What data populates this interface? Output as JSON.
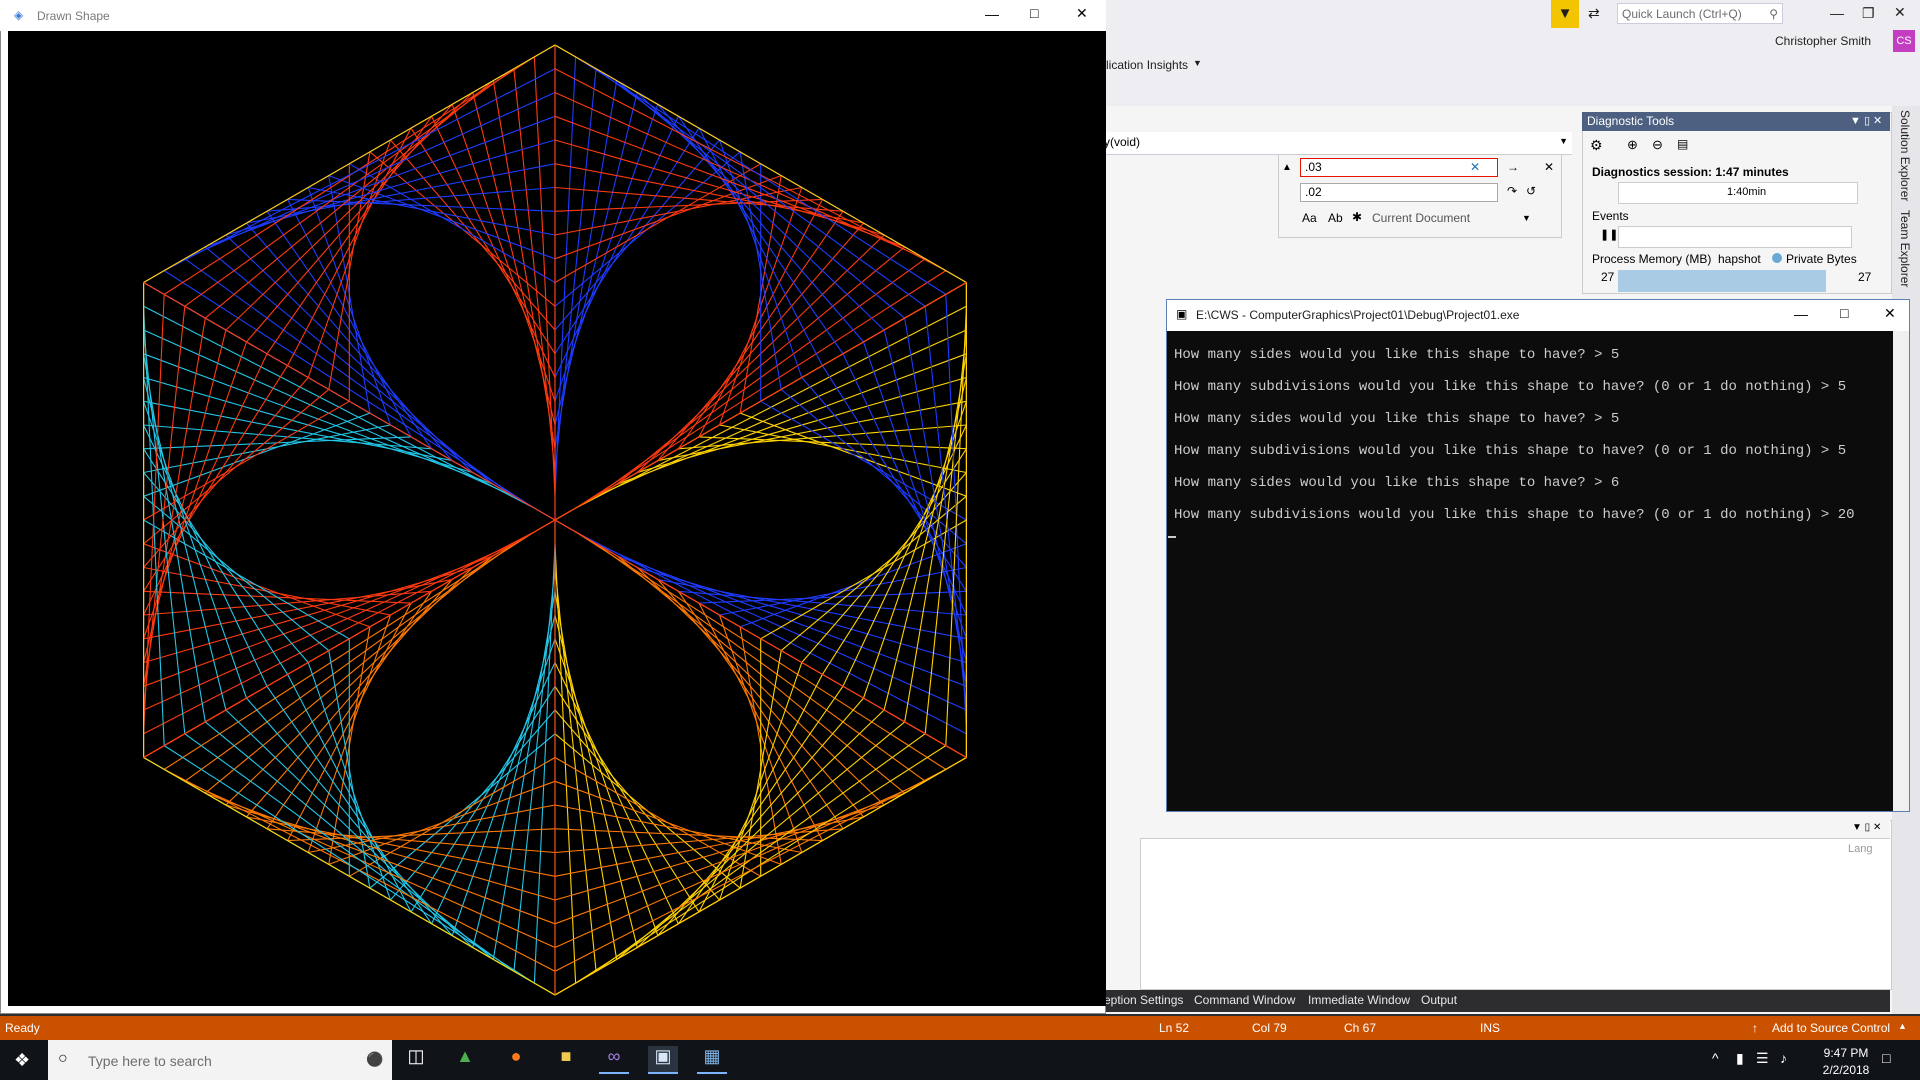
{
  "shape_window": {
    "title": "Drawn Shape",
    "colors": [
      "#1e3cff",
      "#22c7e8",
      "#ffd400",
      "#ff3a10",
      "#ff7a00"
    ],
    "sides": 6,
    "subdivisions": 20
  },
  "vs": {
    "quick_launch_placeholder": "Quick Launch (Ctrl+Q)",
    "user": "Christopher Smith",
    "user_initials": "CS",
    "app_insights": "lication Insights",
    "func_sig": "y(void)",
    "find": {
      "value": ".03",
      "replace_value": ".02",
      "scope": "Current Document",
      "match_case": "Aa",
      "whole_word": "Ab"
    },
    "diagnostic": {
      "title": "Diagnostic Tools",
      "session": "Diagnostics session: 1:47 minutes",
      "timeline_label": "1:40min",
      "events_label": "Events",
      "process_memory_label": "Process Memory (MB)",
      "snapshot_label": "hapshot",
      "private_bytes_label": "Private Bytes",
      "memory_left": "27",
      "memory_right": "27"
    },
    "rails": [
      "Solution Explorer",
      "Team Explorer"
    ],
    "output_col_header": "Lang",
    "bottom_tabs": [
      "eption Settings",
      "Command Window",
      "Immediate Window",
      "Output"
    ],
    "status": {
      "ready": "Ready",
      "ln": "Ln 52",
      "col": "Col 79",
      "ch": "Ch 67",
      "ins": "INS",
      "source_control": "Add to Source Control"
    }
  },
  "console": {
    "title": "E:\\CWS - ComputerGraphics\\Project01\\Debug\\Project01.exe",
    "lines": [
      "How many sides would you like this shape to have? > 5",
      "How many subdivisions would you like this shape to have? (0 or 1 do nothing) > 5",
      "How many sides would you like this shape to have? > 5",
      "How many subdivisions would you like this shape to have? (0 or 1 do nothing) > 5",
      "How many sides would you like this shape to have? > 6",
      "How many subdivisions would you like this shape to have? (0 or 1 do nothing) > 20"
    ]
  },
  "taskbar": {
    "search_placeholder": "Type here to search",
    "time": "9:47 PM",
    "date": "2/2/2018"
  }
}
